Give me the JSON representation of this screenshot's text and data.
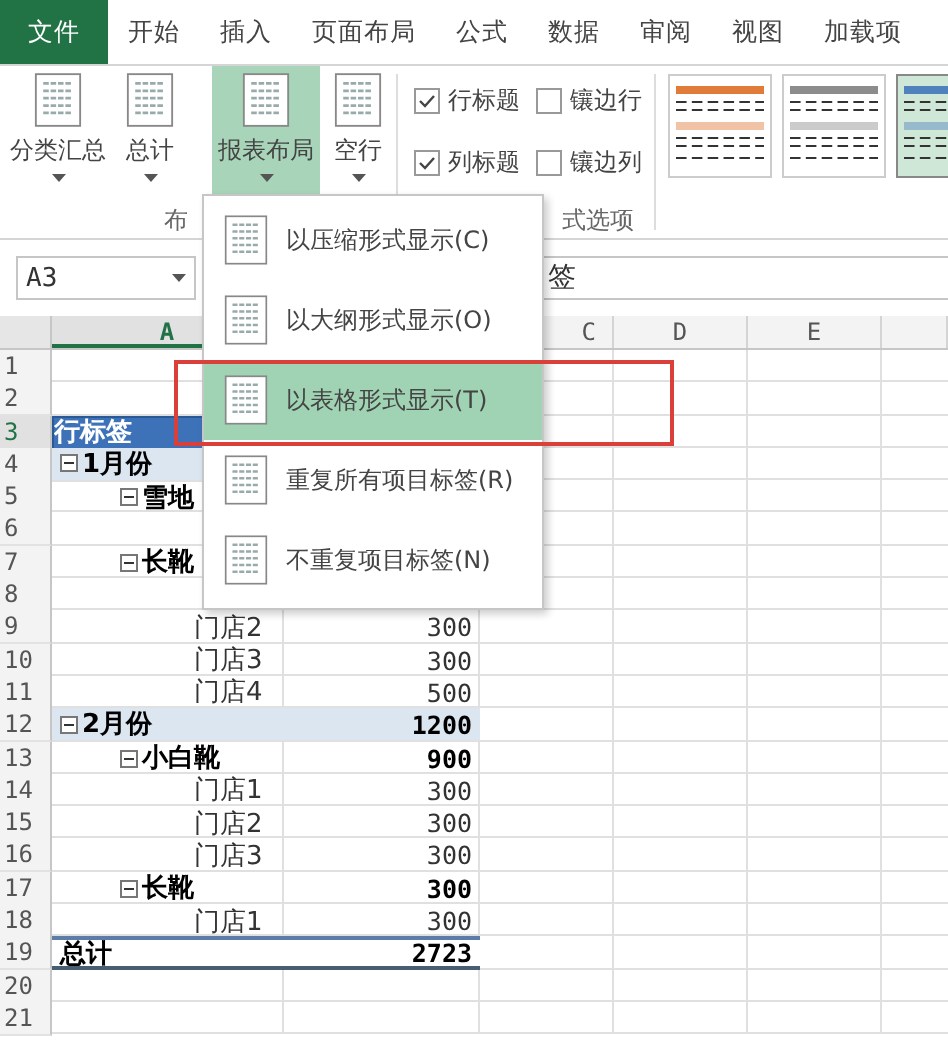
{
  "tabs": [
    {
      "label": "文件",
      "selected": true
    },
    {
      "label": "开始",
      "selected": false
    },
    {
      "label": "插入",
      "selected": false
    },
    {
      "label": "页面布局",
      "selected": false
    },
    {
      "label": "公式",
      "selected": false
    },
    {
      "label": "数据",
      "selected": false
    },
    {
      "label": "审阅",
      "selected": false
    },
    {
      "label": "视图",
      "selected": false
    },
    {
      "label": "加载项",
      "selected": false
    }
  ],
  "ribbon": {
    "buttons": [
      {
        "label": "分类汇总",
        "selected": false
      },
      {
        "label": "总计",
        "selected": false
      },
      {
        "label": "报表布局",
        "selected": true
      },
      {
        "label": "空行",
        "selected": false
      }
    ],
    "layout_group_label": "布",
    "options": [
      {
        "label": "行标题",
        "checked": true
      },
      {
        "label": "镶边行",
        "checked": false
      },
      {
        "label": "列标题",
        "checked": true
      },
      {
        "label": "镶边列",
        "checked": false
      }
    ],
    "options_group_label": "式选项",
    "styles": [
      {
        "color": "#e07b39",
        "selected": false
      },
      {
        "color": "#8c8c8c",
        "selected": false
      },
      {
        "color": "#4f81bd",
        "selected": true
      }
    ]
  },
  "name_box": {
    "value": "A3"
  },
  "formula": {
    "value": "签"
  },
  "columns": [
    {
      "label": "A",
      "selected": true
    },
    {
      "label": "C",
      "selected": false
    },
    {
      "label": "D",
      "selected": false
    },
    {
      "label": "E",
      "selected": false
    }
  ],
  "row_numbers": [
    {
      "label": "1",
      "selected": false
    },
    {
      "label": "2",
      "selected": false
    },
    {
      "label": "3",
      "selected": true
    },
    {
      "label": "4",
      "selected": false
    },
    {
      "label": "5",
      "selected": false
    },
    {
      "label": "6",
      "selected": false
    },
    {
      "label": "7",
      "selected": false
    },
    {
      "label": "8",
      "selected": false
    },
    {
      "label": "9",
      "selected": false
    },
    {
      "label": "10",
      "selected": false
    },
    {
      "label": "11",
      "selected": false
    },
    {
      "label": "12",
      "selected": false
    },
    {
      "label": "13",
      "selected": false
    },
    {
      "label": "14",
      "selected": false
    },
    {
      "label": "15",
      "selected": false
    },
    {
      "label": "16",
      "selected": false
    },
    {
      "label": "17",
      "selected": false
    },
    {
      "label": "18",
      "selected": false
    },
    {
      "label": "19",
      "selected": false
    },
    {
      "label": "20",
      "selected": false
    },
    {
      "label": "21",
      "selected": false
    }
  ],
  "pivot": {
    "header": "行标签",
    "groups": [
      {
        "label": "1月份",
        "expanded": true,
        "children": [
          {
            "label": "雪地",
            "expanded": true,
            "children": [
              {
                "covered": true
              }
            ]
          },
          {
            "label": "长靴",
            "expanded": true,
            "children": [
              {
                "covered": true
              },
              {
                "label": "门店2",
                "value": "300"
              },
              {
                "label": "门店3",
                "value": "300"
              },
              {
                "label": "门店4",
                "value": "500"
              }
            ]
          }
        ]
      },
      {
        "label": "2月份",
        "value": "1200",
        "expanded": true,
        "children": [
          {
            "label": "小白靴",
            "value": "900",
            "expanded": true,
            "children": [
              {
                "label": "门店1",
                "value": "300"
              },
              {
                "label": "门店2",
                "value": "300"
              },
              {
                "label": "门店3",
                "value": "300"
              }
            ]
          },
          {
            "label": "长靴",
            "value": "300",
            "expanded": true,
            "children": [
              {
                "label": "门店1",
                "value": "300"
              }
            ]
          }
        ]
      }
    ],
    "total": {
      "label": "总计",
      "value": "2723"
    }
  },
  "menu": {
    "items": [
      {
        "label": "以压缩形式显示(C)",
        "selected": false
      },
      {
        "label": "以大纲形式显示(O)",
        "selected": false
      },
      {
        "label": "以表格形式显示(T)",
        "selected": true
      },
      {
        "label": "重复所有项目标签(R)",
        "selected": false
      },
      {
        "label": "不重复项目标签(N)",
        "selected": false
      }
    ]
  }
}
